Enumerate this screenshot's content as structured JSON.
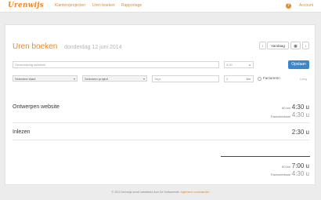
{
  "header": {
    "logo": "Urenwijs",
    "nav": [
      "Klanten/projecten",
      "Uren boeken",
      "Rapportage"
    ],
    "help": "?",
    "account": "Account"
  },
  "page": {
    "title": "Uren boeken",
    "date": "donderdag 12 juni 2014"
  },
  "toolbar": {
    "prev": "‹",
    "today": "Vandaag",
    "calendar_icon": "▦",
    "next": "›"
  },
  "form": {
    "description_placeholder": "Omschrijving activiteit",
    "time_value": "0:00",
    "time_unit": "u",
    "client_select": "Selecteer klant",
    "project_select": "Selecteer project",
    "tags_placeholder": "Tags",
    "km_value": "0",
    "km_unit": "km",
    "save": "Opslaan",
    "invoice_label": "Factureren",
    "clear": "Leeg"
  },
  "entries": [
    {
      "name": "Ontwerpen website",
      "km": "60 km",
      "time": "4:30 u",
      "invoice_label": "Factureerbaar",
      "invoice_time": "4:30 u"
    },
    {
      "name": "Inlezen",
      "time": "2:30 u"
    }
  ],
  "totals": {
    "km": "60 km",
    "time": "7:00 u",
    "invoice_label": "Factureerbaar",
    "invoice_time": "4:30 u"
  },
  "footer": {
    "text": "© 2014 Urenwijs wordt ontwikkeld door De Softwaresite.",
    "link": "Algemene voorwaarden"
  },
  "colors": {
    "accent": "#e8892a",
    "primary_button": "#3a87c9"
  }
}
